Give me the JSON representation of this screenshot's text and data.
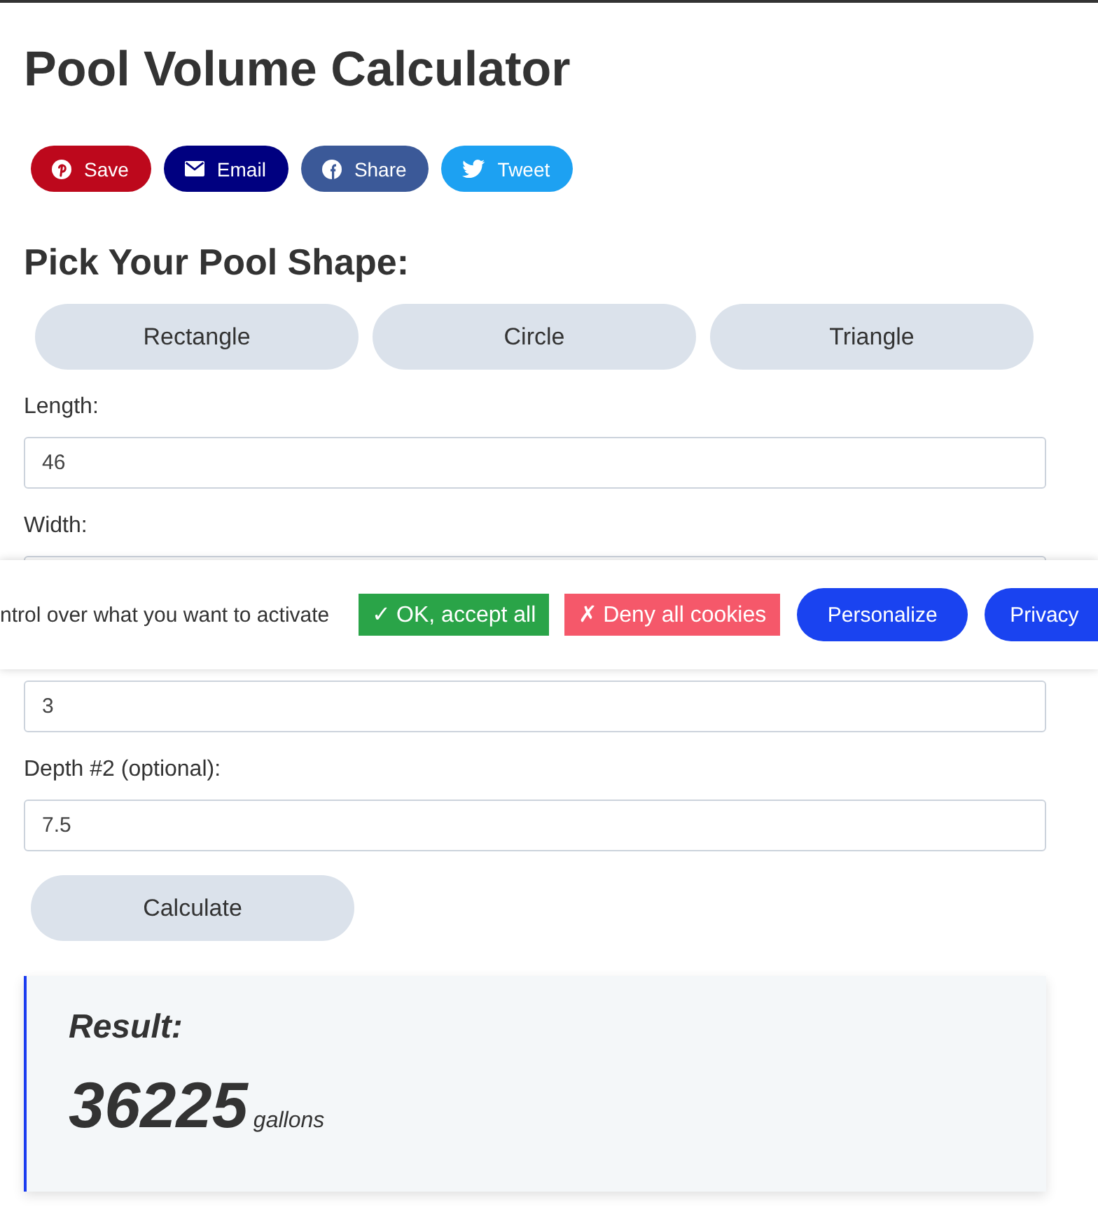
{
  "title": "Pool Volume Calculator",
  "share_buttons": [
    {
      "kind": "pin",
      "label": "Save"
    },
    {
      "kind": "envelope",
      "label": "Email"
    },
    {
      "kind": "circle_f",
      "label": "Share"
    },
    {
      "kind": "bird",
      "label": "Tweet"
    }
  ],
  "shape_heading": "Pick Your Pool Shape:",
  "shapes": [
    {
      "label": "Rectangle",
      "selected": false
    },
    {
      "label": "Circle",
      "selected": false
    },
    {
      "label": "Triangle",
      "selected": false
    }
  ],
  "fields": [
    {
      "label": "Length:",
      "value": "46"
    },
    {
      "label": "Width:"
    },
    {
      "value": "3"
    },
    {
      "label": "Depth #2 (optional):",
      "value": "7.5"
    }
  ],
  "cookie_banner": {
    "message": "ntrol over what you want to activate",
    "buttons": [
      {
        "kind": "accept",
        "label": "✓ OK, accept all"
      },
      {
        "kind": "deny",
        "label": "✗ Deny all cookies"
      },
      {
        "kind": "personalize",
        "label": "Personalize"
      },
      {
        "kind": "privacy",
        "label": "Privacy"
      }
    ]
  },
  "calculate_button": "Calculate",
  "result": {
    "heading": "Result:",
    "value": "36225",
    "unit": "gallons"
  }
}
